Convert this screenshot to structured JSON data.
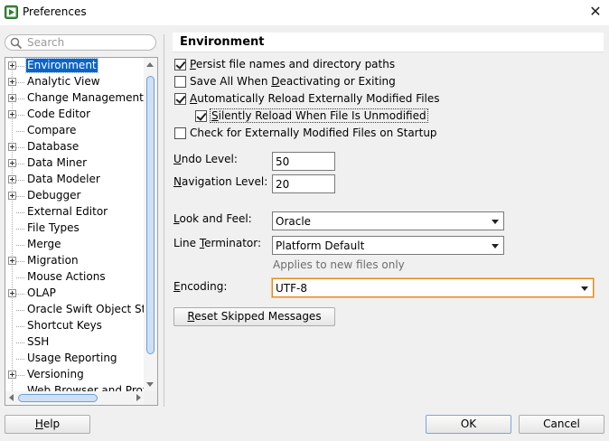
{
  "window": {
    "title": "Preferences",
    "close_glyph": "✕"
  },
  "search": {
    "placeholder": "Search",
    "value": ""
  },
  "tree": {
    "items": [
      {
        "label": "Environment",
        "expandable": true,
        "selected": true
      },
      {
        "label": "Analytic View",
        "expandable": true,
        "selected": false
      },
      {
        "label": "Change Management P",
        "expandable": true,
        "selected": false
      },
      {
        "label": "Code Editor",
        "expandable": true,
        "selected": false
      },
      {
        "label": "Compare",
        "expandable": false,
        "selected": false
      },
      {
        "label": "Database",
        "expandable": true,
        "selected": false
      },
      {
        "label": "Data Miner",
        "expandable": true,
        "selected": false
      },
      {
        "label": "Data Modeler",
        "expandable": true,
        "selected": false
      },
      {
        "label": "Debugger",
        "expandable": true,
        "selected": false
      },
      {
        "label": "External Editor",
        "expandable": false,
        "selected": false
      },
      {
        "label": "File Types",
        "expandable": false,
        "selected": false
      },
      {
        "label": "Merge",
        "expandable": false,
        "selected": false
      },
      {
        "label": "Migration",
        "expandable": true,
        "selected": false
      },
      {
        "label": "Mouse Actions",
        "expandable": false,
        "selected": false
      },
      {
        "label": "OLAP",
        "expandable": true,
        "selected": false
      },
      {
        "label": "Oracle Swift Object Sto",
        "expandable": false,
        "selected": false
      },
      {
        "label": "Shortcut Keys",
        "expandable": false,
        "selected": false
      },
      {
        "label": "SSH",
        "expandable": false,
        "selected": false
      },
      {
        "label": "Usage Reporting",
        "expandable": false,
        "selected": false
      },
      {
        "label": "Versioning",
        "expandable": true,
        "selected": false
      },
      {
        "label": "Web Browser and Prox",
        "expandable": false,
        "selected": false
      }
    ]
  },
  "panel": {
    "title": "Environment",
    "checkboxes": [
      {
        "mnemonic": "P",
        "rest": "ersist file names and directory paths",
        "checked": true
      },
      {
        "pre": "Save All When ",
        "mnemonic": "D",
        "rest": "eactivating or Exiting",
        "checked": false
      },
      {
        "mnemonic": "A",
        "rest": "utomatically Reload Externally Modified Files",
        "checked": true
      },
      {
        "mnemonic": "S",
        "rest": "ilently Reload When File Is Unmodified",
        "checked": true
      },
      {
        "pre": "Check for Externally Modified Files on Startup",
        "mnemonic": "",
        "rest": "",
        "checked": false
      }
    ],
    "undo_level": {
      "mnemonic": "U",
      "rest": "ndo Level:",
      "value": "50"
    },
    "navigation_level": {
      "mnemonic": "N",
      "rest": "avigation Level:",
      "value": "20"
    },
    "look_and_feel": {
      "mnemonic": "L",
      "rest": "ook and Feel:",
      "value": "Oracle"
    },
    "line_terminator": {
      "pre": "Line ",
      "mnemonic": "T",
      "rest": "erminator:",
      "value": "Platform Default"
    },
    "applies_hint": "Applies to new files only",
    "encoding": {
      "mnemonic": "E",
      "rest": "ncoding:",
      "value": "UTF-8"
    },
    "reset_button": {
      "mnemonic": "R",
      "rest": "eset Skipped Messages"
    }
  },
  "footer": {
    "help": {
      "mnemonic": "H",
      "rest": "elp"
    },
    "ok": "OK",
    "cancel": "Cancel"
  },
  "colors": {
    "selection": "#0a64c8",
    "focus_border": "#e08a1e",
    "scroll_thumb": "#cde0f4"
  }
}
